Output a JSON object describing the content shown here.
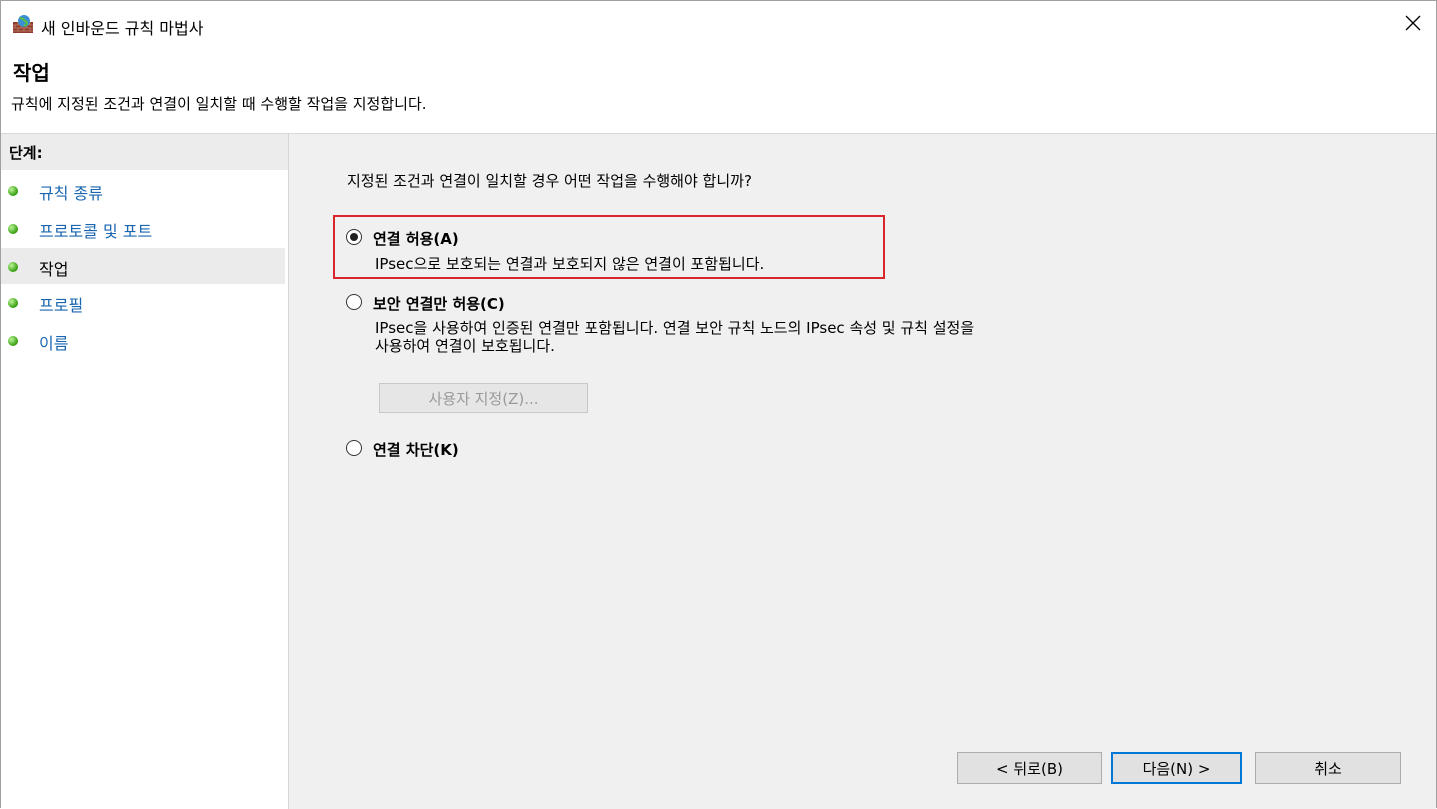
{
  "window": {
    "title": "새 인바운드 규칙 마법사"
  },
  "header": {
    "title": "작업",
    "description": "규칙에 지정된 조건과 연결이 일치할 때 수행할 작업을 지정합니다."
  },
  "sidebar": {
    "title": "단계:",
    "steps": [
      {
        "label": "규칙 종류",
        "active": false
      },
      {
        "label": "프로토콜 및 포트",
        "active": false
      },
      {
        "label": "작업",
        "active": true
      },
      {
        "label": "프로필",
        "active": false
      },
      {
        "label": "이름",
        "active": false
      }
    ]
  },
  "main": {
    "question": "지정된 조건과 연결이 일치할 경우 어떤 작업을 수행해야 합니까?",
    "options": [
      {
        "label": "연결 허용(A)",
        "description": "IPsec으로 보호되는 연결과 보호되지 않은 연결이 포함됩니다.",
        "checked": true
      },
      {
        "label": "보안 연결만 허용(C)",
        "description_line1": "IPsec을 사용하여 인증된 연결만 포함됩니다. 연결 보안 규칙 노드의 IPsec 속성 및 규칙 설정을",
        "description_line2": "사용하여 연결이 보호됩니다.",
        "checked": false
      },
      {
        "label": "연결 차단(K)",
        "checked": false
      }
    ],
    "customize_button": "사용자 지정(Z)..."
  },
  "footer": {
    "back": "< 뒤로(B)",
    "next": "다음(N) >",
    "cancel": "취소"
  },
  "colors": {
    "highlight_border": "#d9262b",
    "link_blue": "#1a66b0",
    "primary_border": "#0078d7"
  }
}
